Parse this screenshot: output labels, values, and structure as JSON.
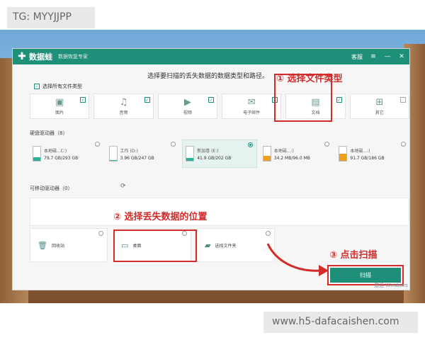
{
  "overlay": {
    "top_tag": "TG: MYYJJPP",
    "bottom_tag": "www.h5-dafacaishen.com"
  },
  "app": {
    "name": "数据蛙",
    "subtitle": "数据恢复专家",
    "menu_label": "客服",
    "accent": "#1e8f78",
    "prompt": "选择要扫描的丢失数据的数据类型和路径。",
    "select_all": "选择所有文件类型"
  },
  "file_types": [
    {
      "label": "图片",
      "icon": "image-icon",
      "checked": true
    },
    {
      "label": "音频",
      "icon": "music-icon",
      "checked": true
    },
    {
      "label": "视频",
      "icon": "video-icon",
      "checked": true
    },
    {
      "label": "电子邮件",
      "icon": "mail-icon",
      "checked": true
    },
    {
      "label": "文档",
      "icon": "document-icon",
      "checked": true
    },
    {
      "label": "其它",
      "icon": "grid-icon",
      "checked": false
    }
  ],
  "hard_drives": {
    "title": "硬盘驱动器（8）",
    "items": [
      {
        "name": "本地磁...C:)",
        "size": "79.7 GB/293 GB",
        "used": 0.27,
        "color": "#2bb39a",
        "selected": false
      },
      {
        "name": "工作 (D:)",
        "size": "3.96 GB/247 GB",
        "used": 0.02,
        "color": "#2bb39a",
        "selected": false
      },
      {
        "name": "新加卷 (E:)",
        "size": "41.9 GB/202 GB",
        "used": 0.21,
        "color": "#2bb39a",
        "selected": true
      },
      {
        "name": "本地磁...:)",
        "size": "34.2 MB/96.0 MB",
        "used": 0.36,
        "color": "#f0a020",
        "selected": false
      },
      {
        "name": "本地磁...:)",
        "size": "91.7 GB/186 GB",
        "used": 0.49,
        "color": "#f0a020",
        "selected": false
      }
    ]
  },
  "removable": {
    "title": "可移动驱动器（0）"
  },
  "locations": [
    {
      "label": "回收站",
      "icon": "trash-icon"
    },
    {
      "label": "桌面",
      "icon": "desktop-icon"
    },
    {
      "label": "选择文件夹",
      "icon": "folder-icon"
    }
  ],
  "annotations": {
    "step1": "① 选择文件类型",
    "step2": "② 选择丢失数据的位置",
    "step3": "③ 点击扫描",
    "color": "#d32a2a"
  },
  "scan_button": "扫描",
  "windows_watermark": "激活 Windows"
}
